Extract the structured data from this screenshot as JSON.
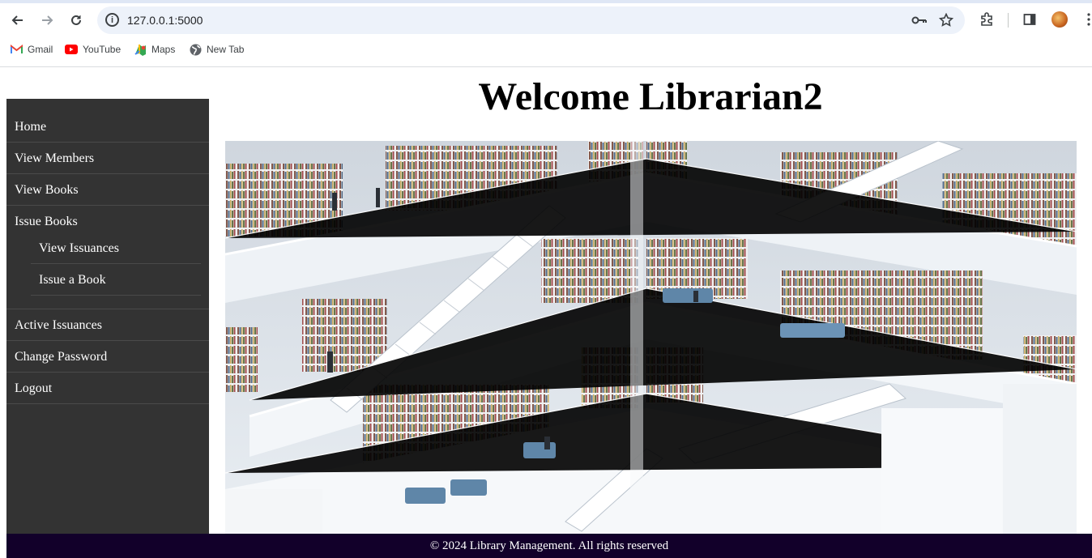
{
  "browser": {
    "url": "127.0.0.1:5000",
    "bookmarks": [
      {
        "label": "Gmail",
        "icon": "gmail-icon"
      },
      {
        "label": "YouTube",
        "icon": "youtube-icon"
      },
      {
        "label": "Maps",
        "icon": "maps-icon"
      },
      {
        "label": "New Tab",
        "icon": "globe-icon"
      }
    ]
  },
  "page": {
    "title": "Welcome Librarian2"
  },
  "sidebar": {
    "items": [
      {
        "label": "Home"
      },
      {
        "label": "View Members"
      },
      {
        "label": "View Books"
      }
    ],
    "group": {
      "label": "Issue Books",
      "subitems": [
        {
          "label": "View Issuances"
        },
        {
          "label": "Issue a Book"
        }
      ]
    },
    "bottom_items": [
      {
        "label": "Active Issuances"
      },
      {
        "label": "Change Password"
      },
      {
        "label": "Logout"
      }
    ]
  },
  "footer": {
    "text": "© 2024 Library Management. All rights reserved"
  },
  "colors": {
    "sidebar_bg": "#333333",
    "footer_bg": "#12002a",
    "omnibox_bg": "#edf2fa"
  }
}
